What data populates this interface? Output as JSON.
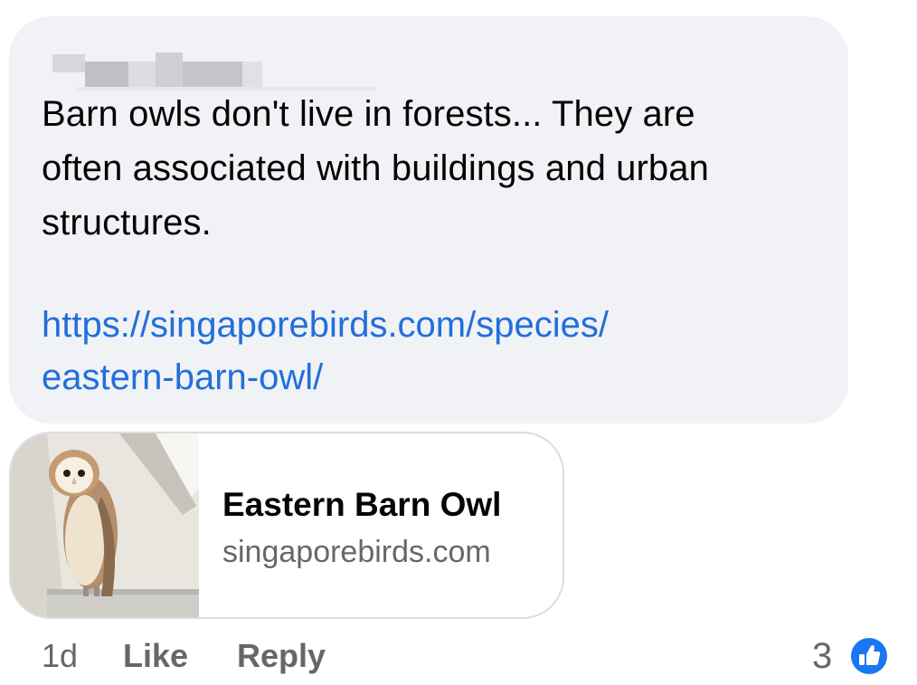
{
  "comment": {
    "text": "Barn owls don't live in forests... They are\noften associated with buildings and urban\nstructures.",
    "link": "https://singaporebirds.com/species/\neastern-barn-owl/"
  },
  "link_preview": {
    "title": "Eastern Barn Owl",
    "domain": "singaporebirds.com",
    "thumbnail_icon": "barn-owl-photo"
  },
  "actions": {
    "time": "1d",
    "like_label": "Like",
    "reply_label": "Reply"
  },
  "reactions": {
    "count": "3",
    "icon": "thumbs-up-icon",
    "badge_color": "#1877f2"
  },
  "colors": {
    "bubble_bg": "#f0f2f5",
    "link": "#216fdb",
    "meta_text": "#65676b"
  }
}
